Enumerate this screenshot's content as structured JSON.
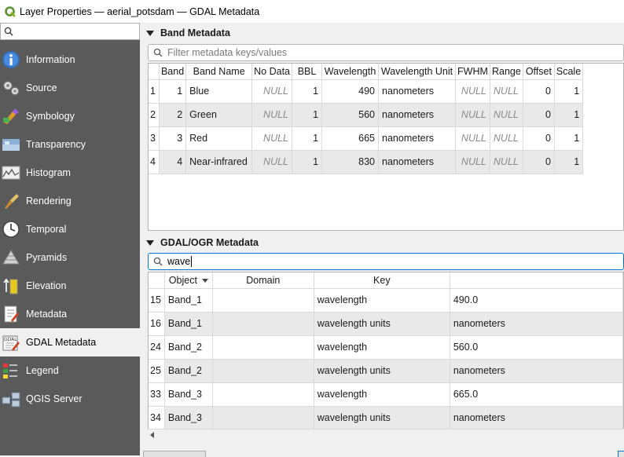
{
  "window": {
    "title": "Layer Properties — aerial_potsdam — GDAL Metadata"
  },
  "sidebar": {
    "search_value": "",
    "items": [
      {
        "label": "Information",
        "icon": "information-icon"
      },
      {
        "label": "Source",
        "icon": "source-icon"
      },
      {
        "label": "Symbology",
        "icon": "symbology-icon"
      },
      {
        "label": "Transparency",
        "icon": "transparency-icon"
      },
      {
        "label": "Histogram",
        "icon": "histogram-icon"
      },
      {
        "label": "Rendering",
        "icon": "rendering-icon"
      },
      {
        "label": "Temporal",
        "icon": "temporal-icon"
      },
      {
        "label": "Pyramids",
        "icon": "pyramids-icon"
      },
      {
        "label": "Elevation",
        "icon": "elevation-icon"
      },
      {
        "label": "Metadata",
        "icon": "metadata-icon"
      },
      {
        "label": "GDAL Metadata",
        "icon": "gdal-icon",
        "selected": true,
        "icon_text": "GDAL"
      },
      {
        "label": "Legend",
        "icon": "legend-icon"
      },
      {
        "label": "QGIS Server",
        "icon": "qgis-server-icon"
      }
    ]
  },
  "band_metadata": {
    "title": "Band Metadata",
    "filter_placeholder": "Filter metadata keys/values",
    "columns": [
      "Band",
      "Band Name",
      "No Data",
      "BBL",
      "Wavelength",
      "Wavelength Unit",
      "FWHM",
      "Range",
      "Offset",
      "Scale"
    ],
    "rows": [
      {
        "row": "1",
        "band": "1",
        "name": "Blue",
        "nodata": "NULL",
        "bbl": "1",
        "wavelength": "490",
        "unit": "nanometers",
        "fwhm": "NULL",
        "range": "NULL",
        "offset": "0",
        "scale": "1"
      },
      {
        "row": "2",
        "band": "2",
        "name": "Green",
        "nodata": "NULL",
        "bbl": "1",
        "wavelength": "560",
        "unit": "nanometers",
        "fwhm": "NULL",
        "range": "NULL",
        "offset": "0",
        "scale": "1"
      },
      {
        "row": "3",
        "band": "3",
        "name": "Red",
        "nodata": "NULL",
        "bbl": "1",
        "wavelength": "665",
        "unit": "nanometers",
        "fwhm": "NULL",
        "range": "NULL",
        "offset": "0",
        "scale": "1"
      },
      {
        "row": "4",
        "band": "4",
        "name": "Near-infrared",
        "nodata": "NULL",
        "bbl": "1",
        "wavelength": "830",
        "unit": "nanometers",
        "fwhm": "NULL",
        "range": "NULL",
        "offset": "0",
        "scale": "1"
      }
    ]
  },
  "gdal_ogr_metadata": {
    "title": "GDAL/OGR Metadata",
    "filter_value": "wave",
    "columns": [
      "Object",
      "Domain",
      "Key",
      ""
    ],
    "rows": [
      {
        "row": "15",
        "object": "Band_1",
        "domain": "",
        "key": "wavelength",
        "value": "490.0"
      },
      {
        "row": "16",
        "object": "Band_1",
        "domain": "",
        "key": "wavelength units",
        "value": "nanometers"
      },
      {
        "row": "24",
        "object": "Band_2",
        "domain": "",
        "key": "wavelength",
        "value": "560.0"
      },
      {
        "row": "25",
        "object": "Band_2",
        "domain": "",
        "key": "wavelength units",
        "value": "nanometers"
      },
      {
        "row": "33",
        "object": "Band_3",
        "domain": "",
        "key": "wavelength",
        "value": "665.0"
      },
      {
        "row": "34",
        "object": "Band_3",
        "domain": "",
        "key": "wavelength units",
        "value": "nanometers"
      }
    ]
  }
}
